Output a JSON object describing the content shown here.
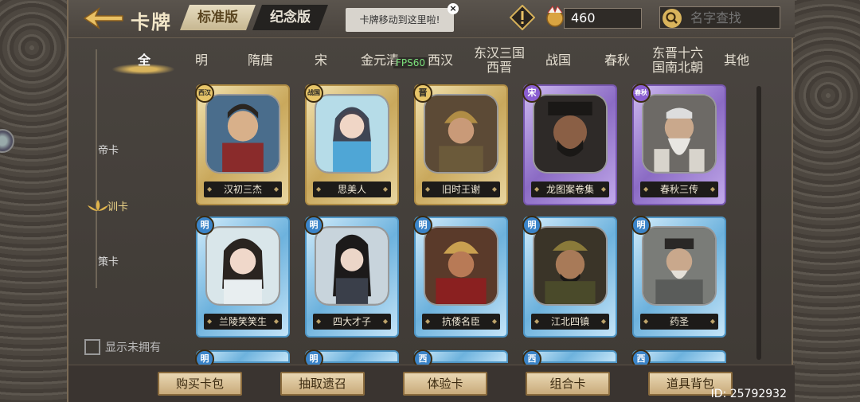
{
  "header": {
    "title": "卡牌",
    "version_tabs": [
      {
        "label": "标准版",
        "active": true
      },
      {
        "label": "纪念版",
        "active": false
      }
    ],
    "tooltip": "卡牌移动到这里啦!",
    "tooltip_close": "×",
    "coins": "460",
    "search_placeholder": "名字查找"
  },
  "dynasty_tabs": [
    "全",
    "明",
    "隋唐",
    "宋",
    "金元清",
    "西汉",
    "东汉三国\n西晋",
    "战国",
    "春秋",
    "东晋十六\n国南北朝",
    "其他"
  ],
  "fps_label": "FPS60",
  "side_nav": [
    {
      "label": "帝卡",
      "active": false
    },
    {
      "label": "训卡",
      "active": true
    },
    {
      "label": "策卡",
      "active": false
    }
  ],
  "show_unowned_label": "显示未拥有",
  "cards": [
    {
      "name": "汉初三杰",
      "badge": "西汉",
      "theme": "gold"
    },
    {
      "name": "思美人",
      "badge": "战国",
      "theme": "gold"
    },
    {
      "name": "旧时王谢",
      "badge": "晋",
      "theme": "gold"
    },
    {
      "name": "龙图案卷集",
      "badge": "宋",
      "theme": "purple"
    },
    {
      "name": "春秋三传",
      "badge": "春秋",
      "theme": "purple"
    },
    {
      "name": "兰陵笑笑生",
      "badge": "明",
      "theme": "blue"
    },
    {
      "name": "四大才子",
      "badge": "明",
      "theme": "blue"
    },
    {
      "name": "抗倭名臣",
      "badge": "明",
      "theme": "blue"
    },
    {
      "name": "江北四镇",
      "badge": "明",
      "theme": "blue"
    },
    {
      "name": "药圣",
      "badge": "明",
      "theme": "blue"
    }
  ],
  "partial_badges": [
    "明",
    "明",
    "西",
    "西",
    "西"
  ],
  "bottom_buttons": [
    "购买卡包",
    "抽取遗召",
    "体验卡",
    "组合卡",
    "道具背包"
  ],
  "uid": "ID: 25792932",
  "colors": {
    "accent_gold": "#d9b45c",
    "background": "#3b3631"
  }
}
